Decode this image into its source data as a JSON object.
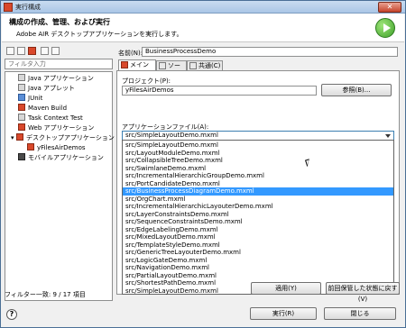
{
  "window": {
    "title": "実行構成",
    "close_glyph": "✕"
  },
  "header": {
    "title": "構成の作成、管理、および実行",
    "description": "Adobe AIR デスクトップアプリケーションを実行します。"
  },
  "left": {
    "filter_placeholder": "フィルタ入力",
    "tree_items": [
      {
        "label": "Java アプリケーション",
        "icon": "java-app-icon"
      },
      {
        "label": "Java アプレット",
        "icon": "java-applet-icon"
      },
      {
        "label": "JUnit",
        "icon": "junit-icon"
      },
      {
        "label": "Maven Build",
        "icon": "maven-icon"
      },
      {
        "label": "Task Context Test",
        "icon": "task-test-icon"
      },
      {
        "label": "Web アプリケーション",
        "icon": "web-app-icon"
      },
      {
        "label": "デスクトップアプリケーション",
        "icon": "desktop-app-icon"
      },
      {
        "label": "yFilesAirDemos",
        "icon": "air-config-icon"
      },
      {
        "label": "モバイルアプリケーション",
        "icon": "mobile-app-icon"
      }
    ],
    "filter_status": "フィルター一致: 9 / 17 項目"
  },
  "right": {
    "name_label": "名前(N):",
    "name_value": "BusinessProcessDemo",
    "tabs": [
      {
        "label": "メイン(M)",
        "icon": "main-tab-icon"
      },
      {
        "label": "ソース",
        "icon": "source-tab-icon"
      },
      {
        "label": "共通(C)",
        "icon": "common-tab-icon"
      }
    ],
    "project_label": "プロジェクト(P):",
    "project_value": "yFilesAirDemos",
    "browse_label": "参照(B)...",
    "appfile_label": "アプリケーションファイル(A):",
    "appfile_value": "src/SimpleLayoutDemo.mxml",
    "options": [
      "src/SimpleLayoutDemo.mxml",
      "src/LayoutModuleDemo.mxml",
      "src/CollapsibleTreeDemo.mxml",
      "src/SwimlaneDemo.mxml",
      "src/IncrementalHierarchicGroupDemo.mxml",
      "src/PortCandidateDemo.mxml",
      "src/BusinessProcessDiagramDemo.mxml",
      "src/OrgChart.mxml",
      "src/IncrementalHierarchicLayouterDemo.mxml",
      "src/LayerConstraintsDemo.mxml",
      "src/SequenceConstraintsDemo.mxml",
      "src/EdgeLabelingDemo.mxml",
      "src/MixedLayoutDemo.mxml",
      "src/TemplateStyleDemo.mxml",
      "src/GenericTreeLayouterDemo.mxml",
      "src/LogicGateDemo.mxml",
      "src/NavigationDemo.mxml",
      "src/PartialLayoutDemo.mxml",
      "src/ShortestPathDemo.mxml",
      "src/SimpleLayoutDemo.mxml"
    ],
    "highlighted_option": "src/BusinessProcessDiagramDemo.mxml",
    "apply_label": "適用(Y)",
    "revert_label": "前回保管した状態に戻す(V)"
  },
  "footer": {
    "run_label": "実行(R)",
    "close_label": "閉じる",
    "help_glyph": "?"
  },
  "colors": {
    "selection": "#3399ff",
    "title_bar": "#aac6e6",
    "run_green": "#3ea02a"
  }
}
